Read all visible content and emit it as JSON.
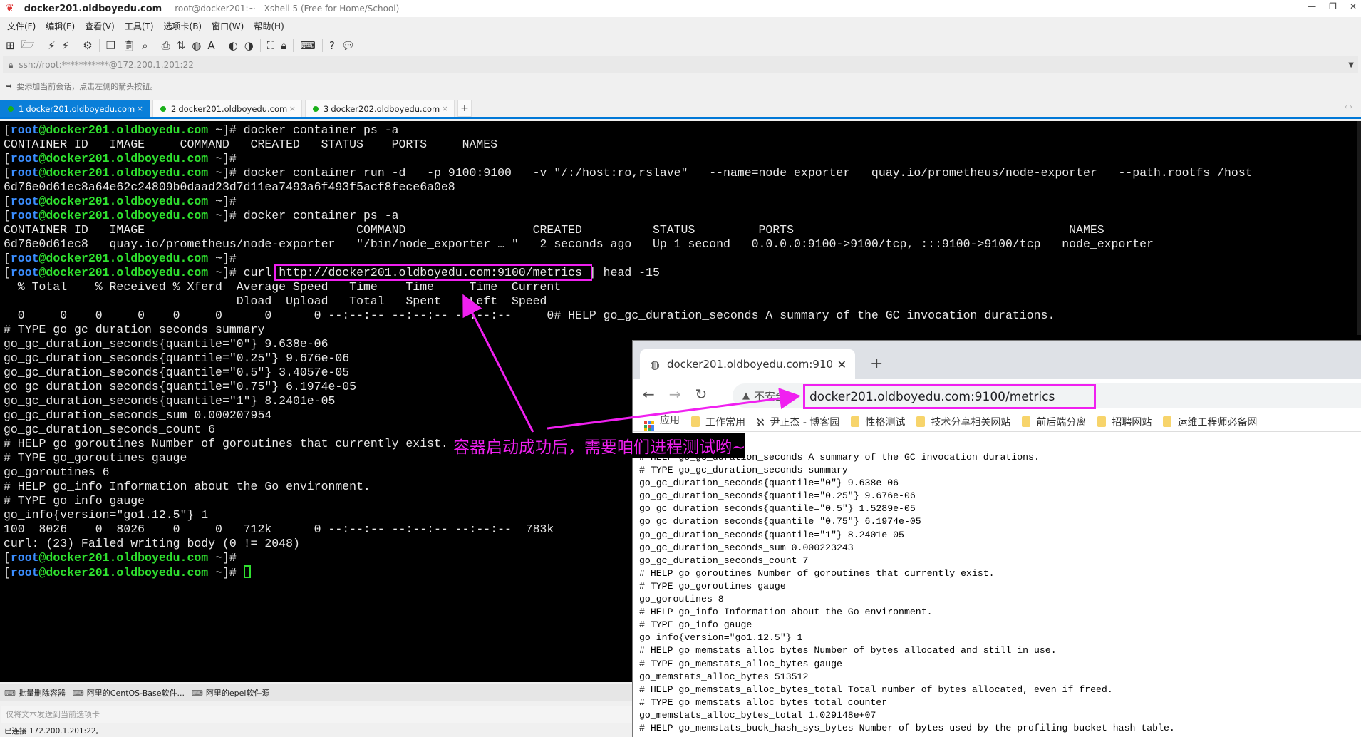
{
  "window": {
    "title_session": "docker201.oldboyedu.com",
    "title_app": "root@docker201:~ - Xshell 5 (Free for Home/School)",
    "controls": [
      "—",
      "❐",
      "✕"
    ]
  },
  "menu": [
    "文件(F)",
    "编辑(E)",
    "查看(V)",
    "工具(T)",
    "选项卡(B)",
    "窗口(W)",
    "帮助(H)"
  ],
  "toolbar_icons": [
    "new-session-icon",
    "open-folder-icon",
    "connect-icon",
    "disconnect-icon",
    "properties-icon",
    "copy-icon",
    "paste-icon",
    "find-icon",
    "print-icon",
    "transfer-icon",
    "globe-icon",
    "font-icon",
    "xftp-icon",
    "xagent-icon",
    "fullscreen-icon",
    "lock-icon",
    "keyboard-icon",
    "help-icon",
    "chat-icon"
  ],
  "address": "ssh://root:***********@172.200.1.201:22",
  "hint": "要添加当前会话，点击左侧的箭头按钮。",
  "tabs": [
    {
      "num": "1",
      "label": "docker201.oldboyedu.com",
      "active": true
    },
    {
      "num": "2",
      "label": "docker201.oldboyedu.com",
      "active": false
    },
    {
      "num": "3",
      "label": "docker202.oldboyedu.com",
      "active": false
    }
  ],
  "prompt": {
    "user": "root",
    "host": "@docker201.oldboyedu.com",
    "path": "~"
  },
  "terminal": [
    {
      "prompt": true,
      "text": "docker container ps -a"
    },
    {
      "text": "CONTAINER ID   IMAGE     COMMAND   CREATED   STATUS    PORTS     NAMES"
    },
    {
      "prompt": true,
      "text": ""
    },
    {
      "prompt": true,
      "text": "docker container run -d   -p 9100:9100   -v \"/:/host:ro,rslave\"   --name=node_exporter   quay.io/prometheus/node-exporter   --path.rootfs /host"
    },
    {
      "text": "6d76e0d61ec8a64e62c24809b0daad23d7d11ea7493a6f493f5acf8fece6a0e8"
    },
    {
      "prompt": true,
      "text": ""
    },
    {
      "prompt": true,
      "text": "docker container ps -a"
    },
    {
      "text": "CONTAINER ID   IMAGE                              COMMAND                  CREATED          STATUS         PORTS                                       NAMES"
    },
    {
      "text": "6d76e0d61ec8   quay.io/prometheus/node-exporter   \"/bin/node_exporter … \"   2 seconds ago   Up 1 second   0.0.0.0:9100->9100/tcp, :::9100->9100/tcp   node_exporter"
    },
    {
      "prompt": true,
      "text": ""
    },
    {
      "prompt": true,
      "text": "curl http://docker201.oldboyedu.com:9100/metrics | head -15"
    },
    {
      "text": "  % Total    % Received % Xferd  Average Speed   Time    Time     Time  Current"
    },
    {
      "text": "                                 Dload  Upload   Total   Spent    Left  Speed"
    },
    {
      "text": "  0     0    0     0    0     0      0      0 --:--:-- --:--:-- --:--:--     0# HELP go_gc_duration_seconds A summary of the GC invocation durations."
    },
    {
      "text": "# TYPE go_gc_duration_seconds summary"
    },
    {
      "text": "go_gc_duration_seconds{quantile=\"0\"} 9.638e-06"
    },
    {
      "text": "go_gc_duration_seconds{quantile=\"0.25\"} 9.676e-06"
    },
    {
      "text": "go_gc_duration_seconds{quantile=\"0.5\"} 3.4057e-05"
    },
    {
      "text": "go_gc_duration_seconds{quantile=\"0.75\"} 6.1974e-05"
    },
    {
      "text": "go_gc_duration_seconds{quantile=\"1\"} 8.2401e-05"
    },
    {
      "text": "go_gc_duration_seconds_sum 0.000207954"
    },
    {
      "text": "go_gc_duration_seconds_count 6"
    },
    {
      "text": "# HELP go_goroutines Number of goroutines that currently exist."
    },
    {
      "text": "# TYPE go_goroutines gauge"
    },
    {
      "text": "go_goroutines 6"
    },
    {
      "text": "# HELP go_info Information about the Go environment."
    },
    {
      "text": "# TYPE go_info gauge"
    },
    {
      "text": "go_info{version=\"go1.12.5\"} 1"
    },
    {
      "text": "100  8026    0  8026    0     0   712k      0 --:--:-- --:--:-- --:--:--  783k"
    },
    {
      "text": "curl: (23) Failed writing body (0 != 2048)"
    },
    {
      "prompt": true,
      "text": ""
    },
    {
      "prompt": true,
      "text": "",
      "cursor": true
    }
  ],
  "annotation": "容器启动成功后，需要咱们进程测试哟~",
  "quick_commands": [
    "批量删除容器",
    "阿里的CentOS-Base软件...",
    "阿里的epel软件源"
  ],
  "send_placeholder": "仅将文本发送到当前选项卡",
  "status": "已连接 172.200.1.201:22。",
  "browser": {
    "tab_title": "docker201.oldboyedu.com:910",
    "not_secure": "不安全",
    "url": "docker201.oldboyedu.com:9100/metrics",
    "bookmarks": [
      "应用",
      "工作常用",
      "尹正杰 - 博客园",
      "性格测试",
      "技术分享相关网站",
      "前后端分离",
      "招聘网站",
      "运维工程师必备网"
    ],
    "content": [
      "# HELP go_gc_duration_seconds A summary of the GC invocation durations.",
      "# TYPE go_gc_duration_seconds summary",
      "go_gc_duration_seconds{quantile=\"0\"} 9.638e-06",
      "go_gc_duration_seconds{quantile=\"0.25\"} 9.676e-06",
      "go_gc_duration_seconds{quantile=\"0.5\"} 1.5289e-05",
      "go_gc_duration_seconds{quantile=\"0.75\"} 6.1974e-05",
      "go_gc_duration_seconds{quantile=\"1\"} 8.2401e-05",
      "go_gc_duration_seconds_sum 0.000223243",
      "go_gc_duration_seconds_count 7",
      "# HELP go_goroutines Number of goroutines that currently exist.",
      "# TYPE go_goroutines gauge",
      "go_goroutines 8",
      "# HELP go_info Information about the Go environment.",
      "# TYPE go_info gauge",
      "go_info{version=\"go1.12.5\"} 1",
      "# HELP go_memstats_alloc_bytes Number of bytes allocated and still in use.",
      "# TYPE go_memstats_alloc_bytes gauge",
      "go_memstats_alloc_bytes 513512",
      "# HELP go_memstats_alloc_bytes_total Total number of bytes allocated, even if freed.",
      "# TYPE go_memstats_alloc_bytes_total counter",
      "go_memstats_alloc_bytes_total 1.029148e+07",
      "# HELP go_memstats_buck_hash_sys_bytes Number of bytes used by the profiling bucket hash table."
    ]
  },
  "colors": {
    "accent": "#0078d7",
    "annotation": "#f020f0",
    "prompt_user": "#3b8eff",
    "prompt_host": "#2fe02f",
    "terminal_bg": "#000000"
  }
}
